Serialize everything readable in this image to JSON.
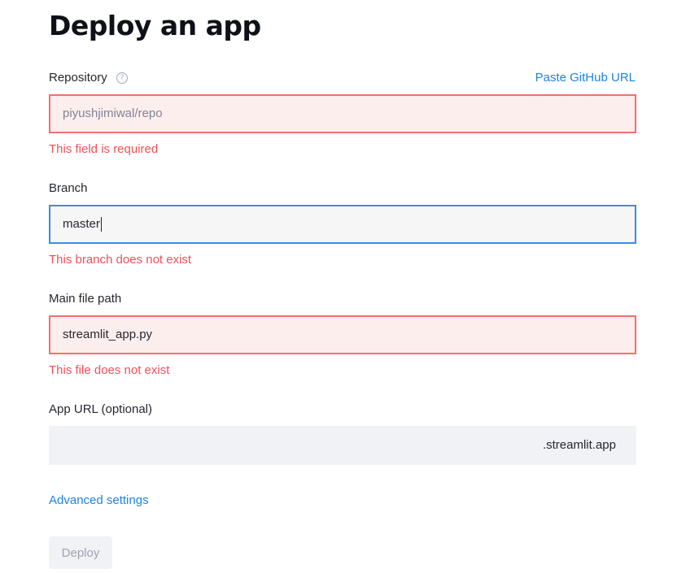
{
  "title": "Deploy an app",
  "repository": {
    "label": "Repository",
    "help_icon": "question-circle-icon",
    "paste_link": "Paste GitHub URL",
    "placeholder": "piyushjimiwal/repo",
    "error": "This field is required"
  },
  "branch": {
    "label": "Branch",
    "value": "master",
    "error": "This branch does not exist"
  },
  "main_file": {
    "label": "Main file path",
    "value": "streamlit_app.py",
    "error": "This file does not exist"
  },
  "app_url": {
    "label": "App URL (optional)",
    "value": "",
    "suffix": ".streamlit.app"
  },
  "advanced_settings": "Advanced settings",
  "deploy_button": "Deploy",
  "colors": {
    "error": "#f0505a",
    "link": "#1c83e1",
    "focus": "#3b8de4"
  }
}
